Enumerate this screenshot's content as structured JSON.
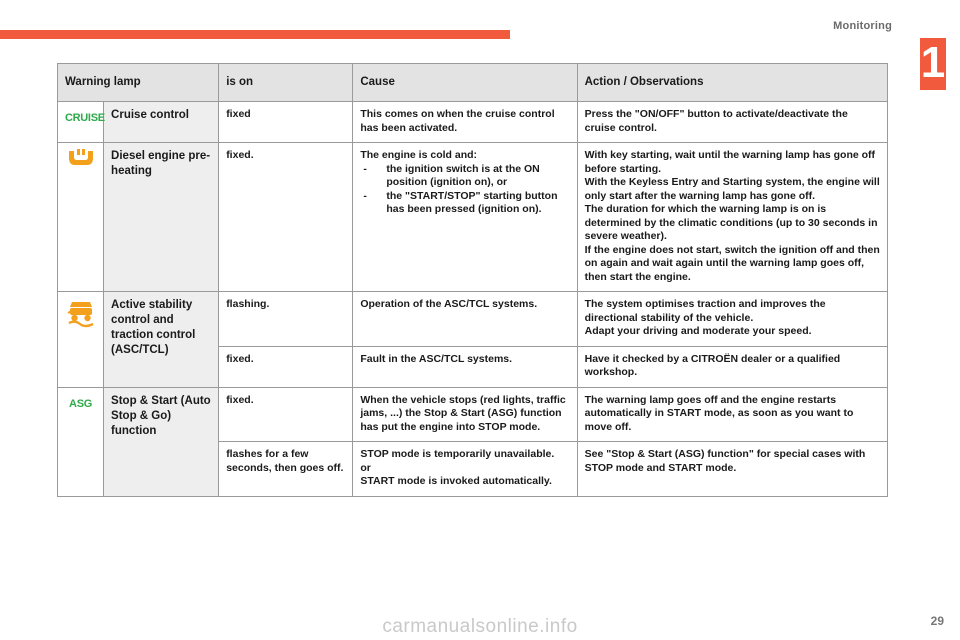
{
  "page": {
    "section_title": "Monitoring",
    "chapter_number": "1",
    "page_number": "29",
    "watermark": "carmanualsonline.info",
    "accent_color": "#f15a3d",
    "lamp_green": "#2eaa4a",
    "lamp_orange": "#f3a01c"
  },
  "table": {
    "headers": {
      "lamp": "Warning lamp",
      "is_on": "is on",
      "cause": "Cause",
      "action": "Action / Observations"
    },
    "rows": [
      {
        "icon": "cruise-control-lamp-icon",
        "icon_label": "CRUISE",
        "icon_color": "#2eaa4a",
        "name": "Cruise control",
        "is_on": "fixed",
        "cause": "This comes on when the cruise control has been activated.",
        "action": "Press the \"ON/OFF\" button to activate/deactivate the cruise control."
      },
      {
        "icon": "diesel-preheating-lamp-icon",
        "icon_label": "",
        "icon_color": "#f3a01c",
        "name": "Diesel engine pre-heating",
        "is_on": "fixed.",
        "cause_intro": "The engine is cold and:",
        "cause_items": [
          "the ignition switch is at the ON position (ignition on), or",
          "the \"START/STOP\" starting button has been pressed (ignition on)."
        ],
        "action_paragraphs": [
          "With key starting, wait until the warning lamp has gone off before starting.",
          "With the Keyless Entry and Starting system, the engine will only start after the warning lamp has gone off.",
          "The duration for which the warning lamp is on is determined by the climatic conditions (up to 30 seconds in severe weather).",
          "If the engine does not start, switch the ignition off and then on again and wait again until the warning lamp goes off, then start the engine."
        ]
      },
      {
        "icon": "asc-tcl-skid-lamp-icon",
        "icon_label": "",
        "icon_color": "#f3a01c",
        "name": "Active stability control and traction control (ASC/TCL)",
        "sub_rows": [
          {
            "is_on": "flashing.",
            "cause": "Operation of the ASC/TCL systems.",
            "action_paragraphs": [
              "The system optimises traction and improves the directional stability of the vehicle.",
              "Adapt your driving and moderate your speed."
            ]
          },
          {
            "is_on": "fixed.",
            "cause": "Fault in the ASC/TCL systems.",
            "action_paragraphs": [
              "Have it checked by a CITROËN dealer or a qualified workshop."
            ]
          }
        ]
      },
      {
        "icon": "stop-start-asg-lamp-icon",
        "icon_label": "ASG",
        "icon_color": "#2eaa4a",
        "name": "Stop & Start (Auto Stop & Go) function",
        "sub_rows": [
          {
            "is_on": "fixed.",
            "cause": "When the vehicle stops (red lights, traffic jams, ...) the Stop & Start (ASG) function has put the engine into STOP mode.",
            "action_paragraphs": [
              "The warning lamp goes off and the engine restarts automatically in START mode, as soon as you want to move off."
            ]
          },
          {
            "is_on": "flashes for a few seconds, then goes off.",
            "cause_paragraphs": [
              "STOP mode is temporarily unavailable.",
              "or",
              "START mode is invoked automatically."
            ],
            "action_paragraphs": [
              "See \"Stop & Start (ASG) function\" for special cases with STOP mode and START mode."
            ]
          }
        ]
      }
    ]
  }
}
